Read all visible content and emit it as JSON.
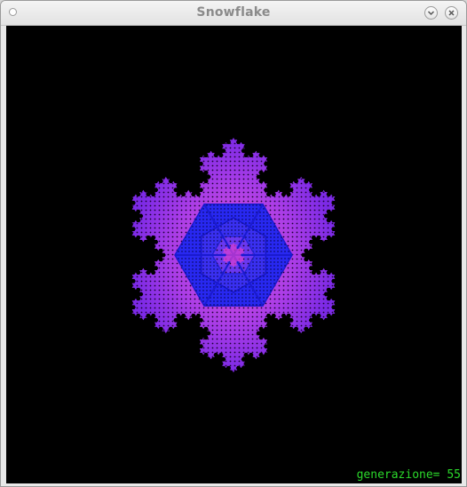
{
  "window": {
    "title": "Snowflake"
  },
  "status": {
    "generation_label": "generazione= 55"
  },
  "colors": {
    "background": "#000000",
    "outer_flake": "#8a2be2",
    "inner_hexagon": "#2828f0",
    "pink_highlight": "#e040d0",
    "status_text": "#2bd82b"
  },
  "icons": {
    "window_menu": "menu-dot-icon",
    "minimize": "chevron-down-icon",
    "close": "close-icon"
  }
}
